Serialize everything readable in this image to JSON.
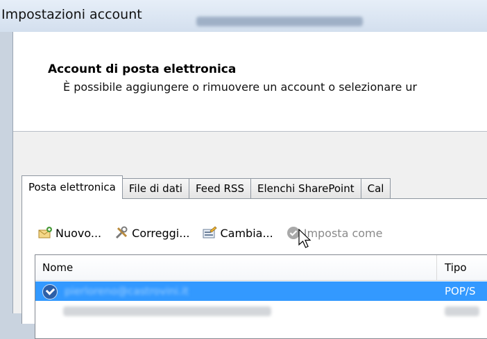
{
  "window": {
    "title": "Impostazioni account"
  },
  "header": {
    "title": "Account di posta elettronica",
    "subtitle": "È possibile aggiungere o rimuovere un account o selezionare ur"
  },
  "tabs": [
    {
      "label": "Posta elettronica",
      "active": true
    },
    {
      "label": "File di dati",
      "active": false
    },
    {
      "label": "Feed RSS",
      "active": false
    },
    {
      "label": "Elenchi SharePoint",
      "active": false
    },
    {
      "label": "Cal",
      "active": false
    }
  ],
  "toolbar": {
    "new_label": "Nuovo...",
    "repair_label": "Correggi...",
    "change_label": "Cambia...",
    "set_default_label": "Imposta come"
  },
  "list": {
    "columns": [
      "Nome",
      "Tipo"
    ],
    "rows": [
      {
        "name": "pierloreno@castrovini.it",
        "type": "POP/S",
        "selected": true,
        "default": true
      }
    ]
  },
  "colors": {
    "selection": "#3399ff",
    "title_bar": "#dbe5f1"
  }
}
